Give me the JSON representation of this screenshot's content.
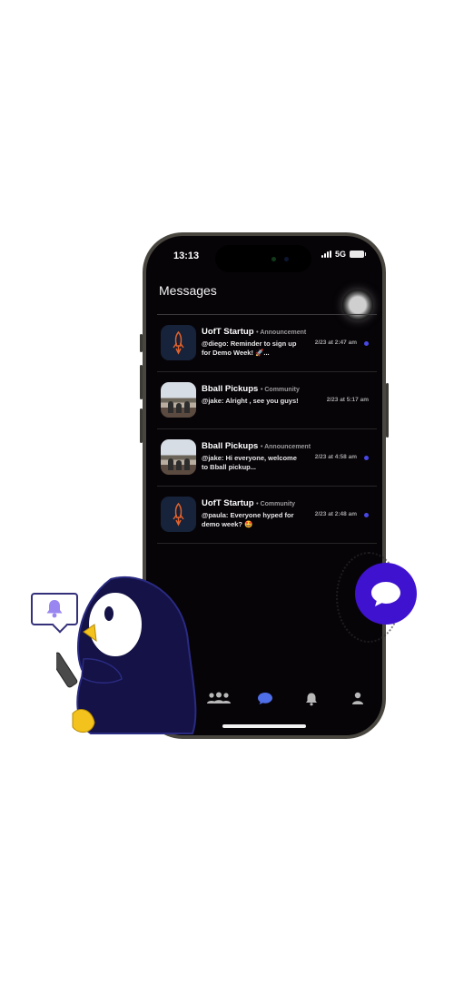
{
  "status": {
    "time": "13:13",
    "network": "5G"
  },
  "header": {
    "title": "Messages"
  },
  "messages": [
    {
      "group": "UofT Startup",
      "type": "Announcement",
      "text": "@diego: Reminder to sign up for Demo Week! 🚀...",
      "time": "2/23 at 2:47 am",
      "unread": true,
      "thumb": "rocket-logo"
    },
    {
      "group": "Bball Pickups",
      "type": "Community",
      "text": "@jake: Alright , see you guys!",
      "time": "2/23 at 5:17 am",
      "unread": false,
      "thumb": "court-photo"
    },
    {
      "group": "Bball Pickups",
      "type": "Announcement",
      "text": "@jake: Hi everyone, welcome to Bball pickup...",
      "time": "2/23 at 4:58 am",
      "unread": true,
      "thumb": "court-photo"
    },
    {
      "group": "UofT Startup",
      "type": "Community",
      "text": "@paula: Everyone hyped for demo week? 🤩",
      "time": "2/23 at 2:48 am",
      "unread": true,
      "thumb": "rocket-logo"
    }
  ],
  "tabs": [
    {
      "name": "communities",
      "icon": "people-icon"
    },
    {
      "name": "messages",
      "icon": "chat-bubble-icon",
      "active": true
    },
    {
      "name": "notifications",
      "icon": "bell-icon"
    },
    {
      "name": "profile",
      "icon": "person-icon"
    }
  ],
  "colors": {
    "accent": "#3f12cf",
    "unread": "#4848e6",
    "screen_bg": "#070408",
    "mascot": "#141246",
    "bell_icon": "#9a86f0"
  }
}
